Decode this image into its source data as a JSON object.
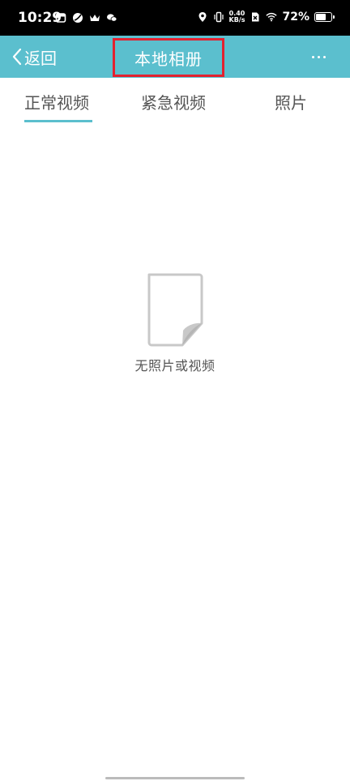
{
  "status_bar": {
    "time": "10:29",
    "net_speed_value": "0.40",
    "net_speed_unit": "KB/s",
    "battery_percent": "72%",
    "battery_level": 0.72
  },
  "header": {
    "back_label": "返回",
    "title": "本地相册",
    "accent_color": "#5bbfce",
    "highlight_color": "#e3212f"
  },
  "tabs": [
    {
      "label": "正常视频",
      "active": true
    },
    {
      "label": "紧急视频",
      "active": false
    },
    {
      "label": "照片",
      "active": false
    }
  ],
  "empty_state": {
    "icon": "empty-document-icon",
    "message": "无照片或视频"
  }
}
